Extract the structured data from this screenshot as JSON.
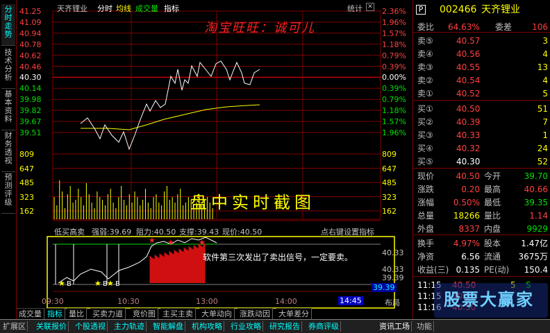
{
  "sidebar": {
    "tabs": [
      "分时走势",
      "技术分析",
      "基本资料",
      "财务透视",
      "预测评级"
    ]
  },
  "header": {
    "title": "天齐锂业",
    "menu": [
      "分时",
      "均线",
      "成交量",
      "指标"
    ],
    "right": "统计"
  },
  "price_labels": [
    "41.25",
    "41.09",
    "40.94",
    "40.78",
    "40.62",
    "40.46",
    "40.30",
    "40.14",
    "39.98",
    "39.82",
    "39.67",
    "39.51"
  ],
  "pct_labels": [
    "2.36%",
    "1.96%",
    "1.57%",
    "1.18%",
    "0.79%",
    "0.39%",
    "0.00%",
    "0.39%",
    "0.79%",
    "1.18%",
    "1.57%",
    "1.96%"
  ],
  "vol_labels": [
    "809",
    "647",
    "485",
    "323",
    "162"
  ],
  "vol_labels_right": [
    "809",
    "647",
    "485",
    "323",
    "162"
  ],
  "watermark1": "淘宝旺旺：诚可儿",
  "watermark2": "盘中实时截图",
  "indicator_line": {
    "name": "低买高卖",
    "strong_weak": "强弱:39.69",
    "resistance": "阻力:40.50",
    "support": "支撑:39.43",
    "current": "现价:40.50",
    "hint": "点右键设置指标"
  },
  "sub_labels": [
    "40.33",
    "39.39"
  ],
  "sub_left_labels": [
    "40.33",
    "39.39"
  ],
  "signal_note": "软件第三次发出了卖出信号，一定要卖。",
  "signal_B": "B",
  "time_axis": [
    "09:30",
    "10:30",
    "13:00",
    "14:00"
  ],
  "time_current": "14:45",
  "layout_label": "布局",
  "chart_tabs": [
    "成交量",
    "指标",
    "量比",
    "买卖力道",
    "竞价图",
    "主买主卖",
    "大单动向",
    "涨跌动因",
    "大单差分"
  ],
  "bottom_tabs": [
    "扩展区",
    "关联报价",
    "个股透视",
    "主力轨迹",
    "智能解盘",
    "机构攻略",
    "行业攻略",
    "研究报告",
    "券商评级"
  ],
  "bottom_right": [
    "资讯工场",
    "功能"
  ],
  "quote": {
    "code": "002466",
    "name": "天齐锂业",
    "letter": "P",
    "ratio_label": "委比",
    "ratio": "64.63%",
    "diff_label": "委差",
    "diff": "106",
    "asks": [
      {
        "l": "卖⑤",
        "p": "40.57",
        "v": "3"
      },
      {
        "l": "卖④",
        "p": "40.56",
        "v": "4"
      },
      {
        "l": "卖③",
        "p": "40.55",
        "v": "13"
      },
      {
        "l": "卖②",
        "p": "40.54",
        "v": "4"
      },
      {
        "l": "卖①",
        "p": "40.52",
        "v": "5"
      }
    ],
    "bids": [
      {
        "l": "买①",
        "p": "40.50",
        "v": "51"
      },
      {
        "l": "买②",
        "p": "40.39",
        "v": "7"
      },
      {
        "l": "买③",
        "p": "40.33",
        "v": "1"
      },
      {
        "l": "买④",
        "p": "40.32",
        "v": "24"
      },
      {
        "l": "买⑤",
        "p": "40.30",
        "v": "52"
      }
    ],
    "stats": [
      {
        "a": "现价",
        "av": "40.50",
        "b": "今开",
        "bv": "39.70"
      },
      {
        "a": "涨跌",
        "av": "0.20",
        "b": "最高",
        "bv": "40.66"
      },
      {
        "a": "涨幅",
        "av": "0.50%",
        "b": "最低",
        "bv": "39.35"
      },
      {
        "a": "总量",
        "av": "18266",
        "b": "量比",
        "bv": "1.14"
      },
      {
        "a": "外盘",
        "av": "8337",
        "b": "内盘",
        "bv": "9929"
      }
    ],
    "stats2": [
      {
        "a": "换手",
        "av": "4.97%",
        "b": "股本",
        "bv": "1.47亿"
      },
      {
        "a": "净资",
        "av": "6.56",
        "b": "流通",
        "bv": "3675万"
      },
      {
        "a": "收益(三)",
        "av": "0.135",
        "b": "PE(动)",
        "bv": "150.4"
      }
    ],
    "ticks": [
      {
        "t": "11:15",
        "p": "40.50",
        "v": "5",
        "f": "S"
      },
      {
        "t": "11:15",
        "p": "40.50",
        "v": "",
        "f": ""
      },
      {
        "t": "11:16",
        "p": "40.50",
        "v": "",
        "f": ""
      }
    ],
    "logo": "股票大赢家"
  },
  "colors": {
    "red": "#ff4040",
    "green": "#00e000",
    "yellow": "#ffff00",
    "grid": "#800000"
  }
}
